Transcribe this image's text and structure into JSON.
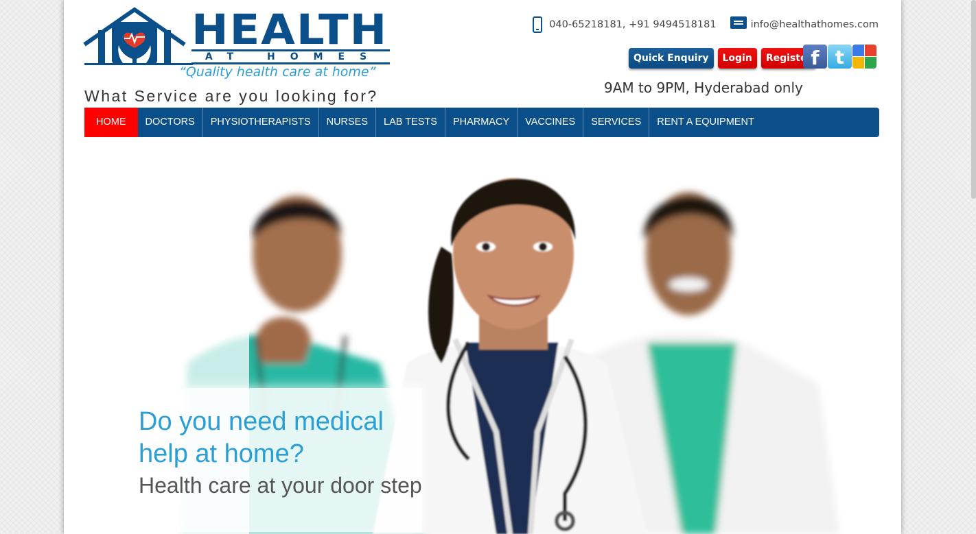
{
  "brand": {
    "title": "HEALTH",
    "subtitle": "AT HOMES",
    "tagline": "“Quality health care at home”"
  },
  "question": "What Service are you looking for?",
  "contact": {
    "phone": "040-65218181, +91 9494518181",
    "email": "info@healthathomes.com",
    "phone_icon": "phone-icon",
    "email_icon": "email-icon"
  },
  "buttons": {
    "enquiry": "Quick Enquiry",
    "login": "Login",
    "register": "Register"
  },
  "social": {
    "facebook": "f",
    "twitter": "t"
  },
  "hours": "9AM to 9PM, Hyderabad only",
  "nav": {
    "items": [
      "HOME",
      "DOCTORS",
      "PHYSIOTHERAPISTS",
      "NURSES",
      "LAB TESTS",
      "PHARMACY",
      "VACCINES",
      "SERVICES",
      "RENT A EQUIPMENT"
    ]
  },
  "hero": {
    "headline": "Do you need medical help at home?",
    "subline": "Health care at your door step"
  },
  "colors": {
    "brand_blue": "#0b4f8a",
    "accent_red": "#ff0000",
    "accent_cyan": "#2a9fd6"
  }
}
